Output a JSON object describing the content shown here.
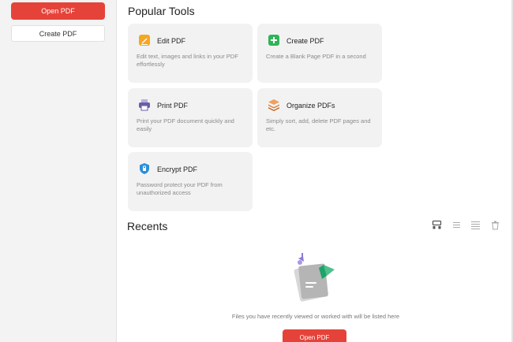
{
  "sidebar": {
    "open_pdf_label": "Open PDF",
    "create_pdf_label": "Create PDF"
  },
  "popular_tools": {
    "title": "Popular Tools",
    "tools": [
      {
        "name": "Edit PDF",
        "desc": "Edit text, images and links in your PDF effortlessly",
        "icon": "edit-icon",
        "color": "#f5a623"
      },
      {
        "name": "Create PDF",
        "desc": "Create a Blank Page PDF in a second",
        "icon": "create-icon",
        "color": "#2fb457"
      },
      {
        "name": "Print PDF",
        "desc": "Print your PDF document quickly and easily",
        "icon": "print-icon",
        "color": "#6b5ea8"
      },
      {
        "name": "Organize PDFs",
        "desc": "Simply sort, add, delete PDF pages and etc.",
        "icon": "organize-icon",
        "color": "#e8772e"
      },
      {
        "name": "Encrypt PDF",
        "desc": "Password protect your PDF from unauthorized access",
        "icon": "encrypt-icon",
        "color": "#2a8fd8"
      }
    ]
  },
  "recents": {
    "title": "Recents",
    "empty_text": "Files you have recently viewed or worked with will be listed here",
    "open_pdf_label": "Open PDF",
    "view_icons": [
      "thumbnail-view-icon",
      "list-view-icon",
      "detail-view-icon",
      "delete-icon"
    ]
  },
  "colors": {
    "accent": "#e5433a",
    "card_bg": "#f2f2f2",
    "sidebar_bg": "#f3f3f3"
  }
}
